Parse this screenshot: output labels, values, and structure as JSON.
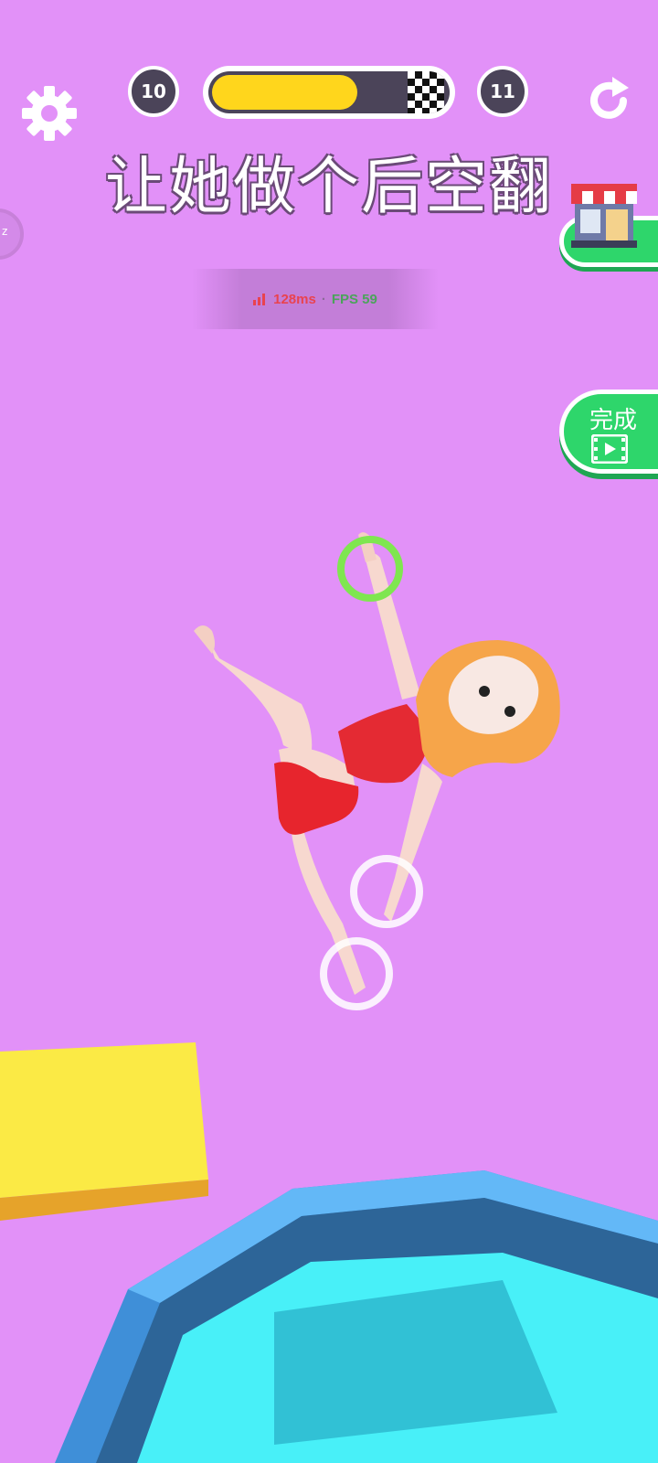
{
  "hud": {
    "current_level": "10",
    "next_level": "11",
    "progress": 0.62,
    "settings_icon": "gear-icon",
    "restart_icon": "restart-icon",
    "shop_icon": "shop-icon",
    "done_icon": "video-play-icon"
  },
  "task": {
    "title": "让她做个后空翻"
  },
  "perf": {
    "ping": "128ms",
    "separator": "·",
    "fps": "FPS 59"
  },
  "buttons": {
    "done_label": "完成"
  },
  "colors": {
    "background": "#e291f8",
    "progress_fill": "#ffd61c",
    "badge": "#4b4459",
    "green_button": "#2ed66b",
    "pool_water": "#48f0f8",
    "pool_rim": "#3f8fd8",
    "yellow_block": "#fbea45",
    "active_handle": "#7fe650"
  }
}
